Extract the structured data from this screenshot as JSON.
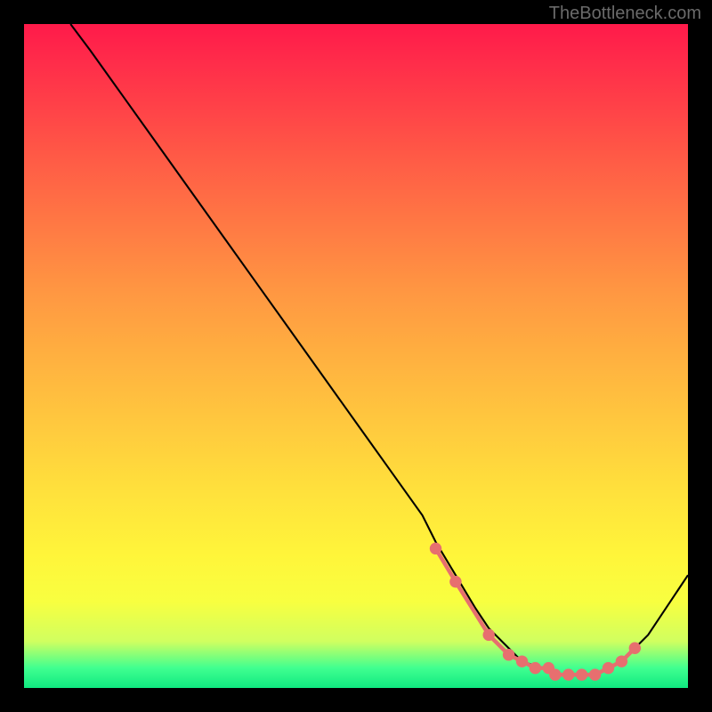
{
  "watermark": "TheBottleneck.com",
  "chart_data": {
    "type": "line",
    "title": "",
    "xlabel": "",
    "ylabel": "",
    "xlim": [
      0,
      100
    ],
    "ylim": [
      0,
      100
    ],
    "grid": false,
    "series": [
      {
        "name": "curve",
        "color": "#000000",
        "x": [
          7,
          10,
          15,
          20,
          25,
          30,
          35,
          40,
          45,
          50,
          55,
          60,
          62,
          65,
          68,
          70,
          73,
          75,
          78,
          80,
          82,
          84,
          86,
          88,
          90,
          92,
          94,
          96,
          98,
          100
        ],
        "values": [
          100,
          96,
          89,
          82,
          75,
          68,
          61,
          54,
          47,
          40,
          33,
          26,
          22,
          17,
          12,
          9,
          6,
          4,
          3,
          2,
          2,
          2,
          2,
          3,
          4,
          6,
          8,
          11,
          14,
          17
        ]
      },
      {
        "name": "markers",
        "color": "#e76f6f",
        "type": "scatter",
        "x": [
          62,
          65,
          70,
          73,
          75,
          77,
          79,
          80,
          82,
          84,
          86,
          88,
          90,
          92
        ],
        "values": [
          21,
          16,
          8,
          5,
          4,
          3,
          3,
          2,
          2,
          2,
          2,
          3,
          4,
          6
        ]
      }
    ],
    "background_gradient": {
      "direction": "vertical",
      "stops": [
        {
          "pos": 0,
          "color": "#ff1a4a"
        },
        {
          "pos": 50,
          "color": "#ffb040"
        },
        {
          "pos": 85,
          "color": "#fff53a"
        },
        {
          "pos": 100,
          "color": "#10e880"
        }
      ]
    }
  }
}
